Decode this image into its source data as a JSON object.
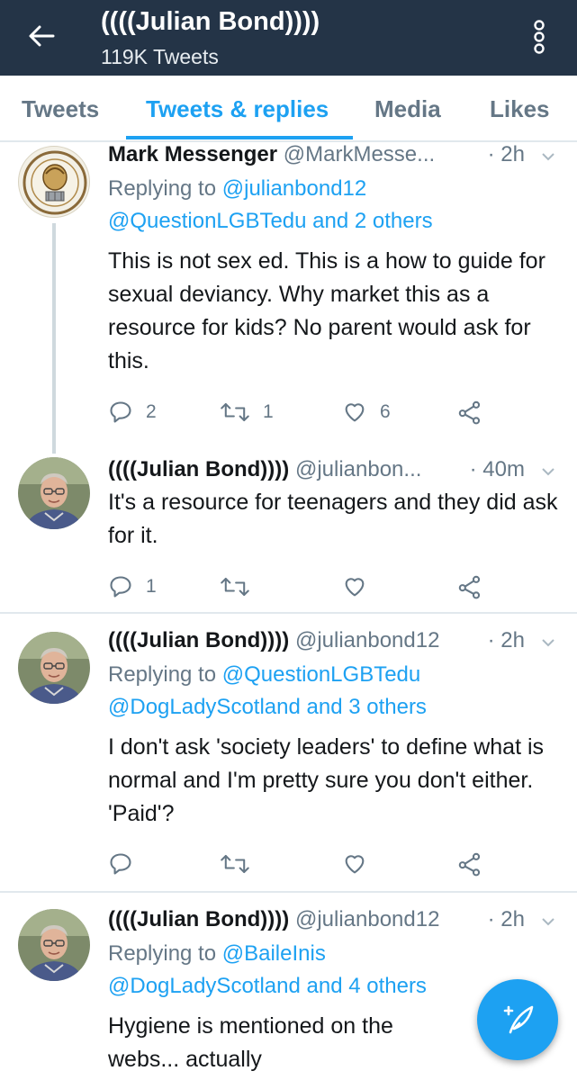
{
  "header": {
    "title": "((((Julian Bond))))",
    "subtitle": "119K Tweets"
  },
  "tabs": [
    {
      "label": "Tweets"
    },
    {
      "label": "Tweets & replies"
    },
    {
      "label": "Media"
    },
    {
      "label": "Likes"
    }
  ],
  "tweets": [
    {
      "name": "Mark Messenger",
      "handle": "@MarkMesse...",
      "time": "· 2h",
      "replying_prefix": "Replying to ",
      "replying_first": "@julianbond12",
      "replying_rest": "@QuestionLGBTedu and 2 others",
      "text": "This is not sex ed. This is a how to guide for sexual deviancy. Why market this as a resource for kids? No parent would ask for this.",
      "replies": "2",
      "retweets": "1",
      "likes": "6"
    },
    {
      "name": "((((Julian Bond))))",
      "handle": "@julianbon...",
      "time": "· 40m",
      "text": "It's a resource for teenagers and they did ask for it.",
      "replies": "1",
      "retweets": "",
      "likes": ""
    },
    {
      "name": "((((Julian Bond))))",
      "handle": "@julianbond12",
      "time": "· 2h",
      "replying_prefix": "Replying to ",
      "replying_first": "@QuestionLGBTedu",
      "replying_rest": "@DogLadyScotland and 3 others",
      "text": "I don't ask 'society leaders' to define what is normal and I'm pretty sure you don't either. 'Paid'?",
      "replies": "",
      "retweets": "",
      "likes": ""
    },
    {
      "name": "((((Julian Bond))))",
      "handle": "@julianbond12",
      "time": "· 2h",
      "replying_prefix": "Replying to ",
      "replying_first": "@BaileInis",
      "replying_rest": "@DogLadyScotland and 4 others",
      "text": "Hygiene is mentioned on the webs... actually"
    }
  ],
  "icons": {
    "back": "arrow-left-icon",
    "overflow": "more-vertical-icon",
    "reply": "reply-icon",
    "retweet": "retweet-icon",
    "like": "heart-icon",
    "share": "share-icon",
    "compose": "feather-icon"
  },
  "colors": {
    "topbar": "#243447",
    "accent": "#1da1f2",
    "muted": "#657786"
  }
}
